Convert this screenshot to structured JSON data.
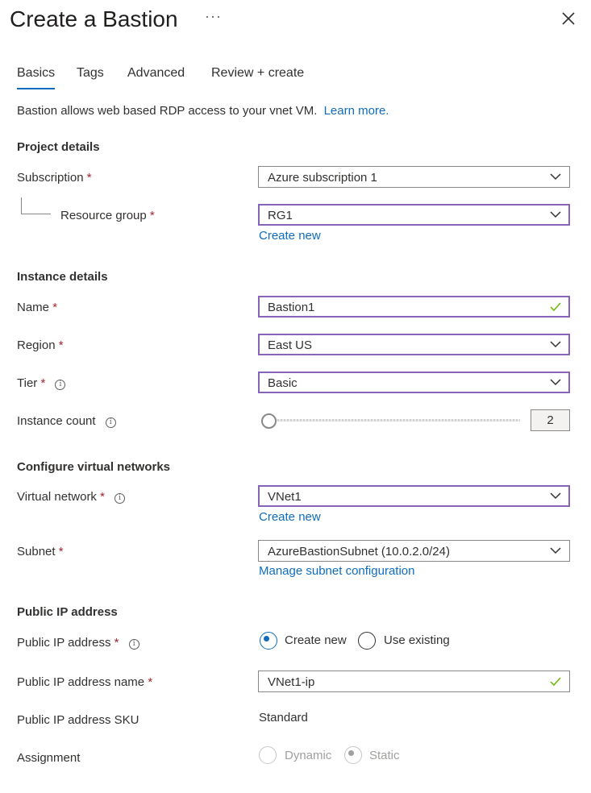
{
  "header": {
    "title": "Create a Bastion",
    "more": "···"
  },
  "tabs": [
    {
      "label": "Basics"
    },
    {
      "label": "Tags"
    },
    {
      "label": "Advanced"
    },
    {
      "label": "Review + create"
    }
  ],
  "intro": {
    "text": "Bastion allows web based RDP access to your vnet VM.",
    "link": "Learn more."
  },
  "project": {
    "heading": "Project details",
    "subscription_label": "Subscription",
    "subscription_value": "Azure subscription 1",
    "resource_group_label": "Resource group",
    "resource_group_value": "RG1",
    "create_new": "Create new"
  },
  "instance": {
    "heading": "Instance details",
    "name_label": "Name",
    "name_value": "Bastion1",
    "region_label": "Region",
    "region_value": "East US",
    "tier_label": "Tier",
    "tier_value": "Basic",
    "count_label": "Instance count",
    "count_value": "2"
  },
  "network": {
    "heading": "Configure virtual networks",
    "vnet_label": "Virtual network",
    "vnet_value": "VNet1",
    "create_new": "Create new",
    "subnet_label": "Subnet",
    "subnet_value": "AzureBastionSubnet (10.0.2.0/24)",
    "manage_link": "Manage subnet configuration"
  },
  "publicip": {
    "heading": "Public IP address",
    "ip_label": "Public IP address",
    "create_new": "Create new",
    "use_existing": "Use existing",
    "name_label": "Public IP address name",
    "name_value": "VNet1-ip",
    "sku_label": "Public IP address SKU",
    "sku_value": "Standard",
    "assignment_label": "Assignment",
    "dynamic": "Dynamic",
    "static": "Static"
  },
  "common": {
    "required_mark": "*",
    "info_glyph": "i"
  },
  "colors": {
    "accent": "#0f6cbd",
    "valid_border": "#8764b8",
    "success": "#6bb700",
    "required": "#a4262c"
  }
}
